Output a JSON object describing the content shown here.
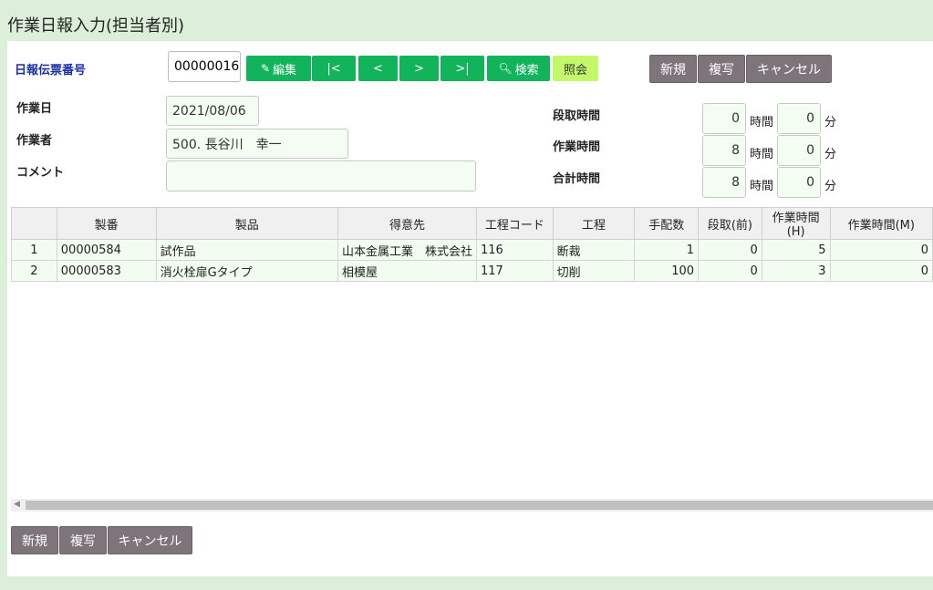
{
  "page": {
    "title": "作業日報入力(担当者別)"
  },
  "header": {
    "slip_label": "日報伝票番号",
    "slip_value": "00000016",
    "buttons": {
      "edit": "編集",
      "first": "|<",
      "prev": "<",
      "next": ">",
      "last": ">|",
      "search": "検索",
      "inquiry": "照会",
      "new": "新規",
      "copy": "複写",
      "cancel": "キャンセル"
    }
  },
  "form": {
    "date_label": "作業日",
    "date_value": "2021/08/06",
    "worker_label": "作業者",
    "worker_value": "500. 長谷川　幸一",
    "comment_label": "コメント",
    "comment_value": "",
    "setup_label": "段取時間",
    "setup_hours": "0",
    "setup_minutes": "0",
    "work_label": "作業時間",
    "work_hours": "8",
    "work_minutes": "0",
    "total_label": "合計時間",
    "total_hours": "8",
    "total_minutes": "0",
    "unit_hours": "時間",
    "unit_minutes": "分"
  },
  "table": {
    "columns": [
      "",
      "製番",
      "製品",
      "得意先",
      "工程コード",
      "工程",
      "手配数",
      "段取(前)",
      "作業時間(H)",
      "作業時間(M)"
    ],
    "rows": [
      [
        "1",
        "00000584",
        "試作品",
        "山本金属工業　株式会社",
        "116",
        "断裁",
        "1",
        "0",
        "5",
        "0"
      ],
      [
        "2",
        "00000583",
        "消火栓扉Gタイプ",
        "相模屋",
        "117",
        "切削",
        "100",
        "0",
        "3",
        "0"
      ]
    ]
  },
  "footer": {
    "new": "新規",
    "copy": "複写",
    "cancel": "キャンセル"
  },
  "colors": {
    "background": "#dcefd9",
    "green_button": "#11b35b",
    "inquiry_button": "#c5f76a",
    "gray_button": "#7e757a",
    "label_blue": "#1a2fa0"
  }
}
